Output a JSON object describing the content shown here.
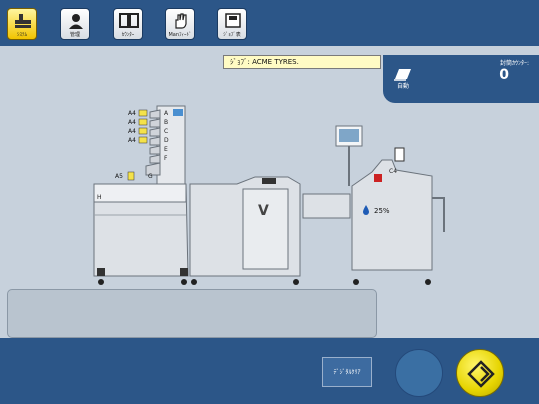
{
  "toolbar": {
    "buttons": [
      {
        "label": "ｼｽﾃﾑ",
        "icon": "system-icon",
        "active": true
      },
      {
        "label": "管理",
        "icon": "user-icon",
        "active": false
      },
      {
        "label": "ｶｳﾝﾀｰ",
        "icon": "counter-icon",
        "active": false
      },
      {
        "label": "Manﾌｨｰﾄﾞ",
        "icon": "manual-feed-hand-icon",
        "active": false
      },
      {
        "label": "ｼﾞｮﾌﾞ表",
        "icon": "job-list-icon",
        "active": false
      }
    ]
  },
  "job": {
    "label": "ｼﾞｮﾌﾞ: ACME TYRES."
  },
  "counter": {
    "title": "封筒ｶｳﾝﾀｰ:",
    "value": "0",
    "mode_label": "自動",
    "mode_icon": "envelope-stack-icon"
  },
  "machine": {
    "feeder_trays": [
      "A",
      "B",
      "C",
      "D",
      "E",
      "F",
      "G",
      "H"
    ],
    "feeder_paper": [
      "A4",
      "A4",
      "A4",
      "A4"
    ],
    "lower_paper": "A5",
    "envelope_size": "C4",
    "ink_level": "25%",
    "module_letter": "V"
  },
  "bottom": {
    "digital_clear_label": "ﾃﾞｼﾞﾀﾙｸﾘｱ"
  },
  "colors": {
    "bar": "#2c5688",
    "workspace": "#c7d1dc",
    "start": "#e6d400"
  }
}
